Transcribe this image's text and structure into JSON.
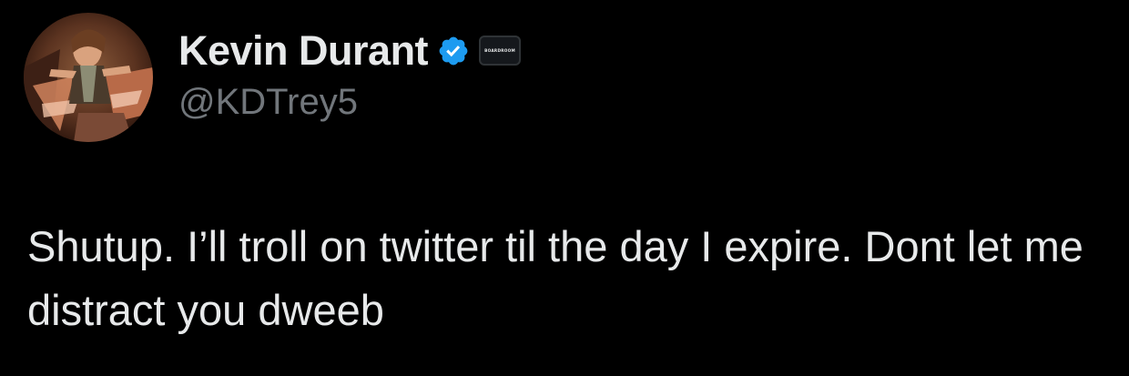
{
  "author": {
    "display_name": "Kevin Durant",
    "handle": "@KDTrey5",
    "verified_icon": "verified-badge-icon",
    "affiliate_label": "BOARDROOM"
  },
  "tweet": {
    "text": "Shutup. I’ll troll on twitter til the day I expire. Dont let me distract you dweeb"
  },
  "colors": {
    "background": "#000000",
    "primary_text": "#e7e9ea",
    "secondary_text": "#71767b",
    "verified_blue": "#1d9bf0"
  }
}
